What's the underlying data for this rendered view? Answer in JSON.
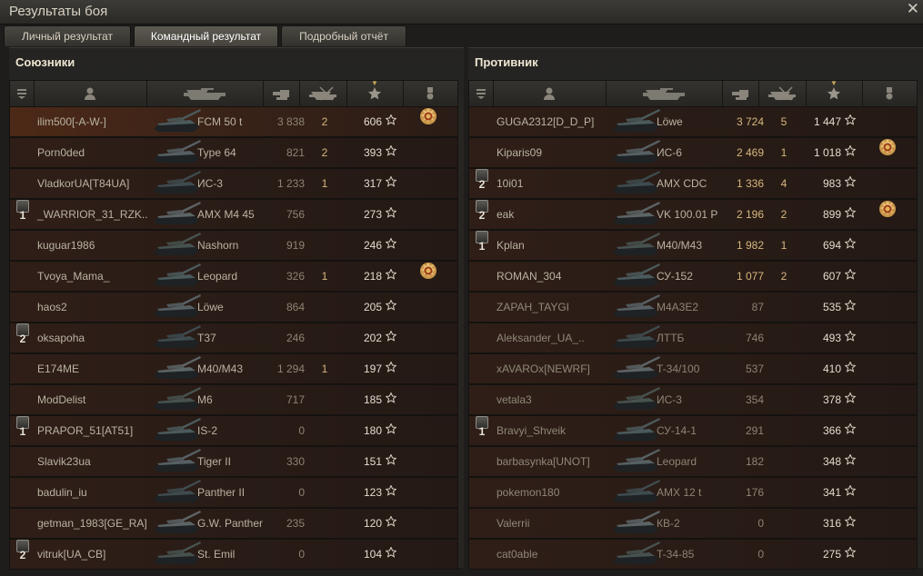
{
  "window": {
    "title": "Результаты боя"
  },
  "tabs": [
    {
      "label": "Личный результат",
      "active": false
    },
    {
      "label": "Командный результат",
      "active": true
    },
    {
      "label": "Подробный отчёт",
      "active": false
    }
  ],
  "header_icons": [
    "platoon-icon",
    "player-icon",
    "vehicle-icon",
    "damage-icon",
    "kills-icon",
    "xp-star-icon",
    "achievements-icon"
  ],
  "colors": {
    "accent": "#d6b77e",
    "row_bg": "#2b1d17",
    "text": "#bab3a2"
  },
  "allies": {
    "title": "Союзники",
    "rows": [
      {
        "platoon": "",
        "name": "ilim500[-A-W-]",
        "vehicle": "FCM 50 t",
        "damage": "3 838",
        "kills": "2",
        "xp": "606",
        "medal": true,
        "me": true
      },
      {
        "platoon": "",
        "name": "Porn0ded",
        "vehicle": "Type 64",
        "damage": "821",
        "kills": "2",
        "xp": "393",
        "medal": false
      },
      {
        "platoon": "",
        "name": "VladkorUA[T84UA]",
        "vehicle": "ИС-3",
        "damage": "1 233",
        "kills": "1",
        "xp": "317",
        "medal": false
      },
      {
        "platoon": "1",
        "name": "_WARRIOR_31_RZK..",
        "vehicle": "AMX M4 45",
        "damage": "756",
        "kills": "",
        "xp": "273",
        "medal": false
      },
      {
        "platoon": "",
        "name": "kuguar1986",
        "vehicle": "Nashorn",
        "damage": "919",
        "kills": "",
        "xp": "246",
        "medal": false
      },
      {
        "platoon": "",
        "name": "Tvoya_Mama_",
        "vehicle": "Leopard",
        "damage": "326",
        "kills": "1",
        "xp": "218",
        "medal": true
      },
      {
        "platoon": "",
        "name": "haos2",
        "vehicle": "Löwe",
        "damage": "864",
        "kills": "",
        "xp": "205",
        "medal": false
      },
      {
        "platoon": "2",
        "name": "oksapoha",
        "vehicle": "T37",
        "damage": "246",
        "kills": "",
        "xp": "202",
        "medal": false
      },
      {
        "platoon": "",
        "name": "E174ME",
        "vehicle": "M40/M43",
        "damage": "1 294",
        "kills": "1",
        "xp": "197",
        "medal": false
      },
      {
        "platoon": "",
        "name": "ModDelist",
        "vehicle": "M6",
        "damage": "717",
        "kills": "",
        "xp": "185",
        "medal": false
      },
      {
        "platoon": "1",
        "name": "PRAPOR_51[AT51]",
        "vehicle": "IS-2",
        "damage": "0",
        "kills": "",
        "xp": "180",
        "medal": false
      },
      {
        "platoon": "",
        "name": "Slavik23ua",
        "vehicle": "Tiger II",
        "damage": "330",
        "kills": "",
        "xp": "151",
        "medal": false
      },
      {
        "platoon": "",
        "name": "badulin_iu",
        "vehicle": "Panther II",
        "damage": "0",
        "kills": "",
        "xp": "123",
        "medal": false
      },
      {
        "platoon": "",
        "name": "getman_1983[GE_RA]",
        "vehicle": "G.W. Panther",
        "damage": "235",
        "kills": "",
        "xp": "120",
        "medal": false
      },
      {
        "platoon": "2",
        "name": "vitruk[UA_CB]",
        "vehicle": "St. Emil",
        "damage": "0",
        "kills": "",
        "xp": "104",
        "medal": false
      }
    ]
  },
  "enemies": {
    "title": "Противник",
    "rows": [
      {
        "platoon": "",
        "name": "GUGA2312[D_D_P]",
        "vehicle": "Löwe",
        "damage": "3 724",
        "kills": "5",
        "xp": "1 447",
        "medal": false
      },
      {
        "platoon": "",
        "name": "Kiparis09",
        "vehicle": "ИС-6",
        "damage": "2 469",
        "kills": "1",
        "xp": "1 018",
        "medal": true
      },
      {
        "platoon": "2",
        "name": "10i01",
        "vehicle": "AMX CDC",
        "damage": "1 336",
        "kills": "4",
        "xp": "983",
        "medal": false
      },
      {
        "platoon": "2",
        "name": "eak",
        "vehicle": "VK 100.01 P",
        "damage": "2 196",
        "kills": "2",
        "xp": "899",
        "medal": true
      },
      {
        "platoon": "1",
        "name": "Kplan",
        "vehicle": "M40/M43",
        "damage": "1 982",
        "kills": "1",
        "xp": "694",
        "medal": false
      },
      {
        "platoon": "",
        "name": "ROMAN_304",
        "vehicle": "СУ-152",
        "damage": "1 077",
        "kills": "2",
        "xp": "607",
        "medal": false
      },
      {
        "platoon": "",
        "name": "ZAPAH_TAYGI",
        "vehicle": "M4A3E2",
        "damage": "87",
        "kills": "",
        "xp": "535",
        "medal": false,
        "dead": true
      },
      {
        "platoon": "",
        "name": "Aleksander_UA_..",
        "vehicle": "ЛТТБ",
        "damage": "746",
        "kills": "",
        "xp": "493",
        "medal": false,
        "dead": true
      },
      {
        "platoon": "",
        "name": "xAVAROx[NEWRF]",
        "vehicle": "T-34/100",
        "damage": "537",
        "kills": "",
        "xp": "410",
        "medal": false,
        "dead": true
      },
      {
        "platoon": "",
        "name": "vetala3",
        "vehicle": "ИС-3",
        "damage": "354",
        "kills": "",
        "xp": "378",
        "medal": false,
        "dead": true
      },
      {
        "platoon": "1",
        "name": "Bravyi_Shveik",
        "vehicle": "СУ-14-1",
        "damage": "291",
        "kills": "",
        "xp": "366",
        "medal": false,
        "dead": true
      },
      {
        "platoon": "",
        "name": "barbasynka[UNOT]",
        "vehicle": "Leopard",
        "damage": "182",
        "kills": "",
        "xp": "348",
        "medal": false,
        "dead": true
      },
      {
        "platoon": "",
        "name": "pokemon180",
        "vehicle": "AMX 12 t",
        "damage": "176",
        "kills": "",
        "xp": "341",
        "medal": false,
        "dead": true
      },
      {
        "platoon": "",
        "name": "Valerrii",
        "vehicle": "КВ-2",
        "damage": "0",
        "kills": "",
        "xp": "316",
        "medal": false,
        "dead": true
      },
      {
        "platoon": "",
        "name": "cat0able",
        "vehicle": "T-34-85",
        "damage": "0",
        "kills": "",
        "xp": "275",
        "medal": false,
        "dead": true
      }
    ]
  }
}
